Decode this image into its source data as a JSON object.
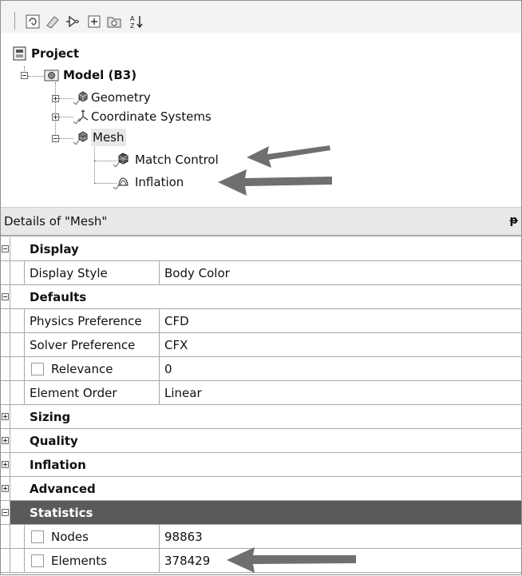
{
  "toolbar": {
    "buttons": [
      "refresh-icon",
      "clear-icon",
      "probe-icon",
      "expand-all-icon",
      "folder-icon",
      "sort-az-icon"
    ],
    "sort_label": "A Z"
  },
  "tree": {
    "project": "Project",
    "model": "Model (B3)",
    "geometry": "Geometry",
    "coordinate_systems": "Coordinate Systems",
    "mesh": "Mesh",
    "match_control": "Match Control",
    "inflation": "Inflation"
  },
  "details": {
    "title": "Details of \"Mesh\"",
    "pin": "ᵽ",
    "rows": [
      {
        "kind": "category",
        "label": "Display"
      },
      {
        "kind": "prop",
        "name": "Display Style",
        "value": "Body Color"
      },
      {
        "kind": "category",
        "label": "Defaults"
      },
      {
        "kind": "prop",
        "name": "Physics Preference",
        "value": "CFD"
      },
      {
        "kind": "prop",
        "name": "Solver Preference",
        "value": "CFX"
      },
      {
        "kind": "prop",
        "name": "Relevance",
        "value": "0"
      },
      {
        "kind": "prop",
        "name": "Element Order",
        "value": "Linear"
      },
      {
        "kind": "category",
        "label": "Sizing"
      },
      {
        "kind": "category",
        "label": "Quality"
      },
      {
        "kind": "category",
        "label": "Inflation"
      },
      {
        "kind": "category",
        "label": "Advanced"
      },
      {
        "kind": "category",
        "label": "Statistics"
      },
      {
        "kind": "prop",
        "name": "Nodes",
        "value": "98863"
      },
      {
        "kind": "prop",
        "name": "Elements",
        "value": "378429"
      }
    ]
  },
  "colors": {
    "statistics_header_bg": "#5a5a5a",
    "grid_line": "#a8a8a8",
    "arrow": "#6f6f6f"
  }
}
